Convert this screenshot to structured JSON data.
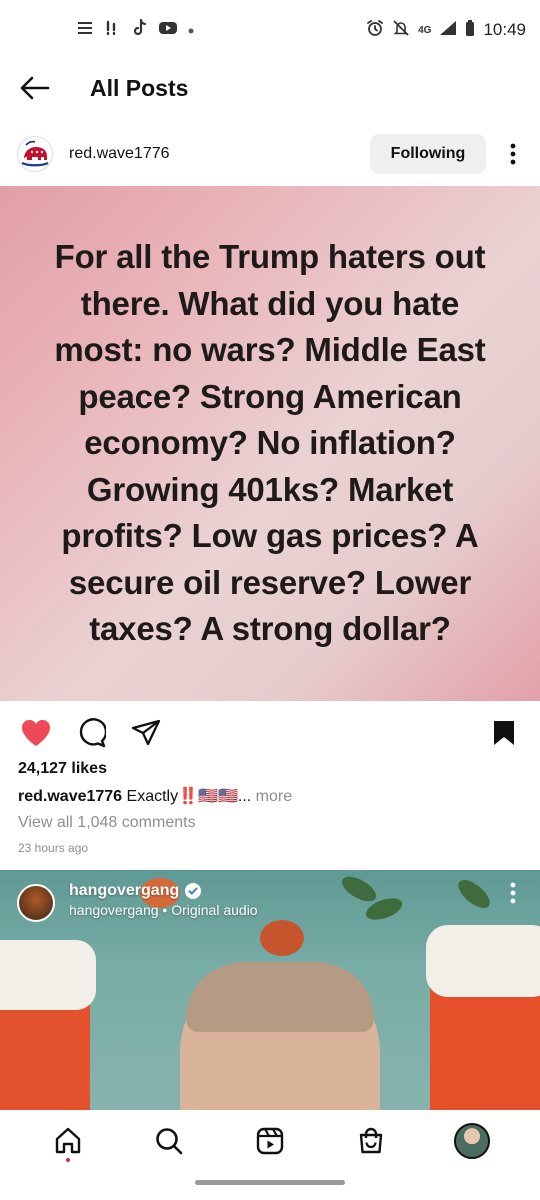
{
  "status_bar": {
    "time": "10:49",
    "network": "4G"
  },
  "header": {
    "title": "All Posts"
  },
  "post": {
    "username": "red.wave1776",
    "follow_label": "Following",
    "image_text": "For all the Trump haters out there. What did you hate most: no wars? Middle East peace? Strong American economy? No inflation? Growing 401ks? Market profits? Low gas prices? A secure oil reserve? Lower taxes? A strong dollar?",
    "likes": "24,127 likes",
    "caption_user": "red.wave1776",
    "caption_text": "Exactly‼️🇺🇸🇺🇸...",
    "caption_more": "more",
    "view_comments": "View all 1,048 comments",
    "time_ago": "23 hours ago",
    "liked": true,
    "saved": true
  },
  "next_post": {
    "username": "hangovergang",
    "subtitle": "hangovergang • Original audio"
  },
  "nav": {
    "items": [
      "home",
      "search",
      "reels",
      "shop",
      "profile"
    ]
  },
  "colors": {
    "like_red": "#ed4956",
    "link_gray": "#8e8e8e",
    "follow_bg": "#efefef"
  }
}
